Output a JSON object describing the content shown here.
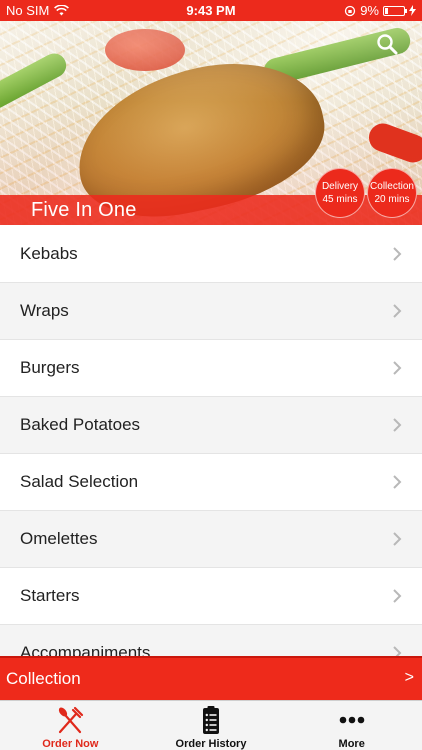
{
  "status_bar": {
    "carrier": "No SIM",
    "time": "9:43 PM",
    "battery_percent": "9%",
    "battery_level": 0.09
  },
  "hero": {
    "restaurant_name": "Five In One",
    "delivery": {
      "label": "Delivery",
      "time": "45 mins"
    },
    "collection": {
      "label": "Collection",
      "time": "20 mins"
    }
  },
  "menu": {
    "categories": [
      {
        "label": "Kebabs"
      },
      {
        "label": "Wraps"
      },
      {
        "label": "Burgers"
      },
      {
        "label": "Baked Potatoes"
      },
      {
        "label": "Salad Selection"
      },
      {
        "label": "Omelettes"
      },
      {
        "label": "Starters"
      },
      {
        "label": "Accompaniments"
      }
    ]
  },
  "order_bar": {
    "mode_label": "Collection",
    "arrow": ">"
  },
  "tab_bar": {
    "tabs": [
      {
        "label": "Order Now",
        "icon": "fork-knife-icon",
        "active": true
      },
      {
        "label": "Order History",
        "icon": "clipboard-list-icon",
        "active": false
      },
      {
        "label": "More",
        "icon": "more-dots-icon",
        "active": false
      }
    ]
  },
  "colors": {
    "brand_red": "#ec2a1c",
    "active_tab": "#e0291b"
  }
}
